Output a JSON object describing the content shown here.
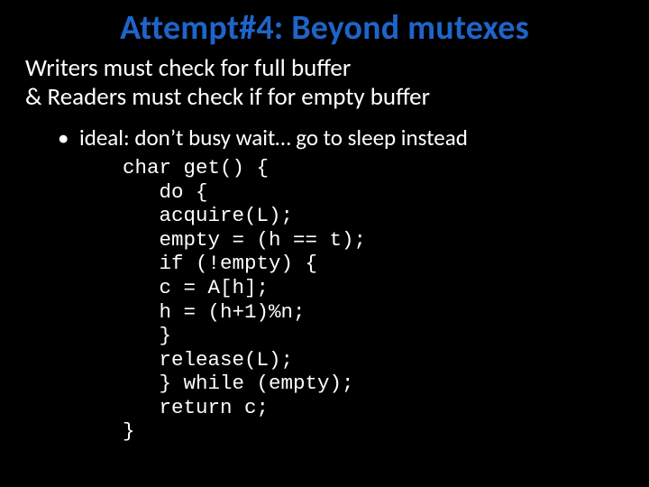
{
  "title": "Attempt#4: Beyond mutexes",
  "line1": "Writers must check for full buffer",
  "line2": "& Readers must check if for empty buffer",
  "bullet1": "ideal: don’t busy wait… go to sleep instead",
  "code": "char get() {\n   do {\n   acquire(L);\n   empty = (h == t);\n   if (!empty) {\n   c = A[h];\n   h = (h+1)%n;\n   }\n   release(L);\n   } while (empty);\n   return c;\n}"
}
